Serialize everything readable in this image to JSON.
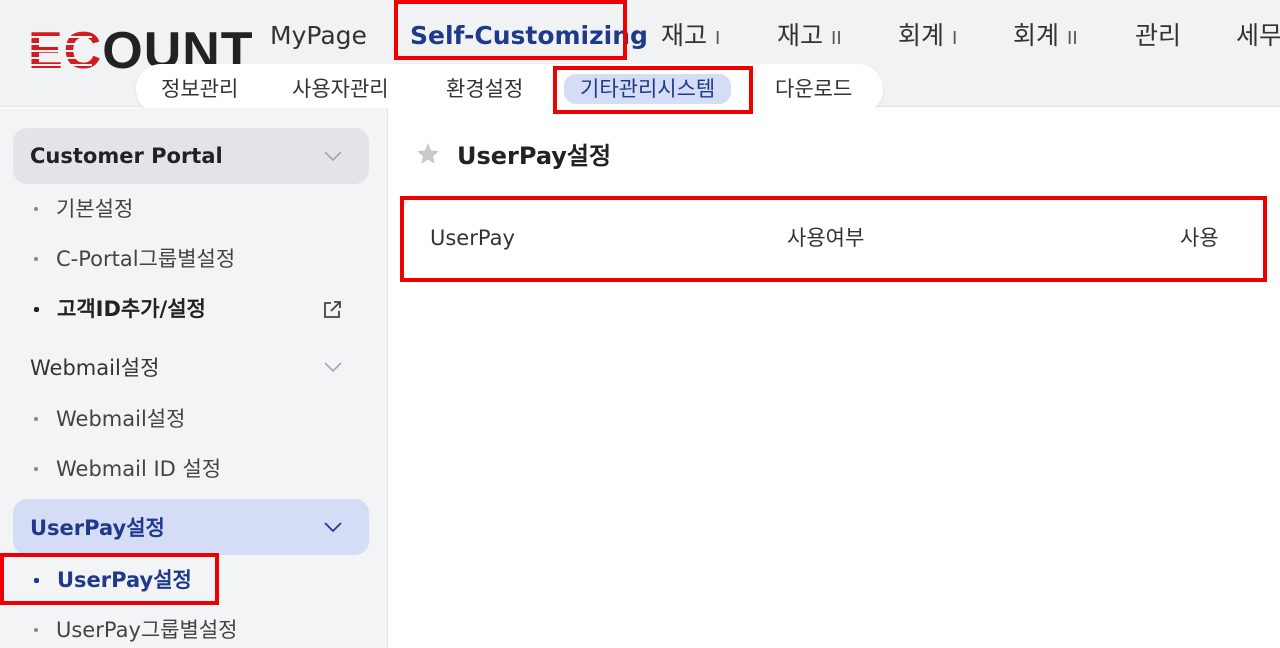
{
  "brand": {
    "logo_text": "ECOUNT",
    "accent_red": "#cf1d22",
    "accent_blue": "#1f3a8a",
    "highlight_color": "#ee0000"
  },
  "topnav": {
    "items": [
      {
        "label": "MyPage",
        "suffix": ""
      },
      {
        "label": "Self-Customizing",
        "suffix": ""
      },
      {
        "label": "재고",
        "suffix": "I"
      },
      {
        "label": "재고",
        "suffix": "II"
      },
      {
        "label": "회계",
        "suffix": "I"
      },
      {
        "label": "회계",
        "suffix": "II"
      },
      {
        "label": "관리",
        "suffix": ""
      },
      {
        "label": "세무",
        "suffix": ""
      }
    ],
    "active": "Self-Customizing"
  },
  "subnav": {
    "items": [
      "정보관리",
      "사용자관리",
      "환경설정",
      "기타관리시스템",
      "다운로드"
    ],
    "active": "기타관리시스템"
  },
  "sidebar": {
    "groups": [
      {
        "title": "Customer Portal",
        "items": [
          "기본설정",
          "C-Portal그룹별설정",
          "고객ID추가/설정"
        ]
      },
      {
        "title": "Webmail설정",
        "items": [
          "Webmail설정",
          "Webmail ID 설정"
        ]
      },
      {
        "title": "UserPay설정",
        "items": [
          "UserPay설정",
          "UserPay그룹별설정"
        ]
      }
    ]
  },
  "main": {
    "title": "UserPay설정",
    "row": {
      "name": "UserPay",
      "field": "사용여부",
      "value": "사용"
    }
  }
}
